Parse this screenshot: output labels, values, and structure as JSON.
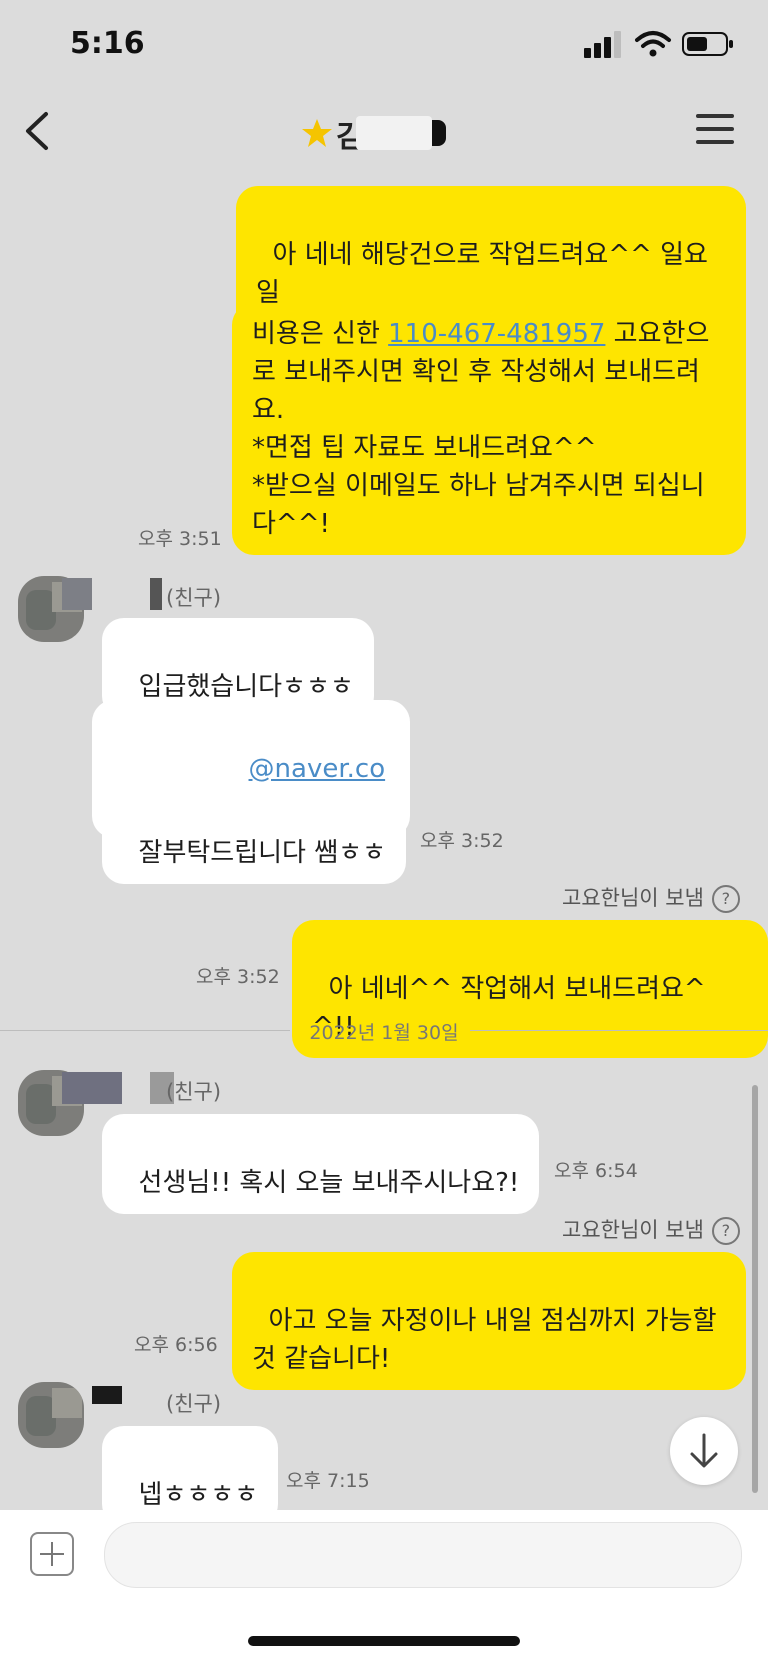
{
  "status_bar": {
    "time": "5:16"
  },
  "header": {
    "title_partial": "김"
  },
  "messages": {
    "m1": "아 네네 해당건으로 작업드려요^^ 일요일\n까지는 해드려요!",
    "m2_pre": "비용은 신한 ",
    "m2_account": "110-467-481957",
    "m2_post": " 고요한으\n로 보내주시면 확인 후 작성해서 보내드려\n요.\n*면접 팁 자료도 보내드려요^^\n*받으실 이메일도 하나 남겨주시면 되십니\n다^^!",
    "m2_time": "오후 3:51",
    "friend_tag": "(친구)",
    "m3": "입급했습니다ㅎㅎㅎ",
    "m4_email_domain": "@naver.com",
    "m5": "잘부탁드립니다 쌤ㅎㅎ",
    "m5_time": "오후 3:52",
    "sent_by": "고요한님이 보냄",
    "m6": "아 네네^^ 작업해서 보내드려요^^!!",
    "m6_time": "오후 3:52",
    "date_separator": "2022년 1월 30일",
    "m7": "선생님!! 혹시 오늘 보내주시나요?!",
    "m7_time": "오후 6:54",
    "m8": "아고 오늘 자정이나 내일 점심까지 가능할\n것 같습니다!",
    "m8_time": "오후 6:56",
    "m9": "넵ㅎㅎㅎㅎ",
    "m9_time": "오후 7:15"
  },
  "input": {
    "placeholder": ""
  },
  "colors": {
    "my_bubble": "#fee500",
    "other_bubble": "#ffffff",
    "background": "#dcdcdc",
    "link": "#4a8cc7"
  },
  "icons": [
    "back-arrow-icon",
    "star-icon",
    "menu-icon",
    "question-icon",
    "arrow-down-icon",
    "plus-icon"
  ]
}
